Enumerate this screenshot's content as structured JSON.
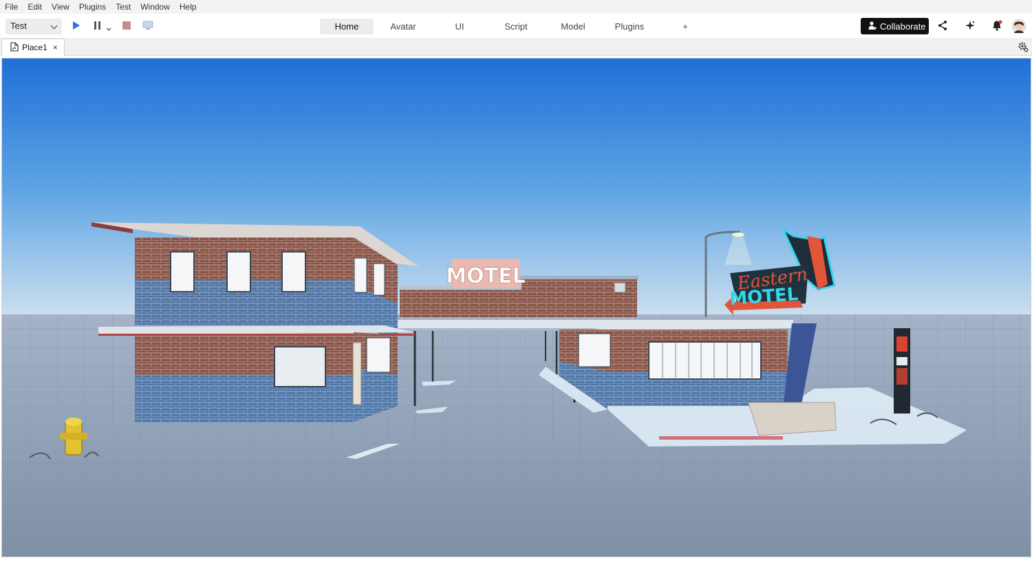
{
  "menu": [
    "File",
    "Edit",
    "View",
    "Plugins",
    "Test",
    "Window",
    "Help"
  ],
  "toolbar": {
    "mode_value": "Test",
    "ribbon_tabs": [
      "Home",
      "Avatar",
      "UI",
      "Script",
      "Model",
      "Plugins",
      "+"
    ],
    "active_tab": "Home",
    "collaborate_label": "Collaborate"
  },
  "document_tab": {
    "label": "Place1",
    "close": "×"
  },
  "scene": {
    "billboard_text": "MOTEL",
    "sign_script_text": "Eastern",
    "sign_main_text": "MOTEL"
  },
  "colors": {
    "play_blue": "#2f6fe0",
    "stop_red": "#c98b8b",
    "sign_orange": "#e2553a",
    "sign_cyan": "#35d6e8",
    "notification_dot": "#e53935"
  }
}
